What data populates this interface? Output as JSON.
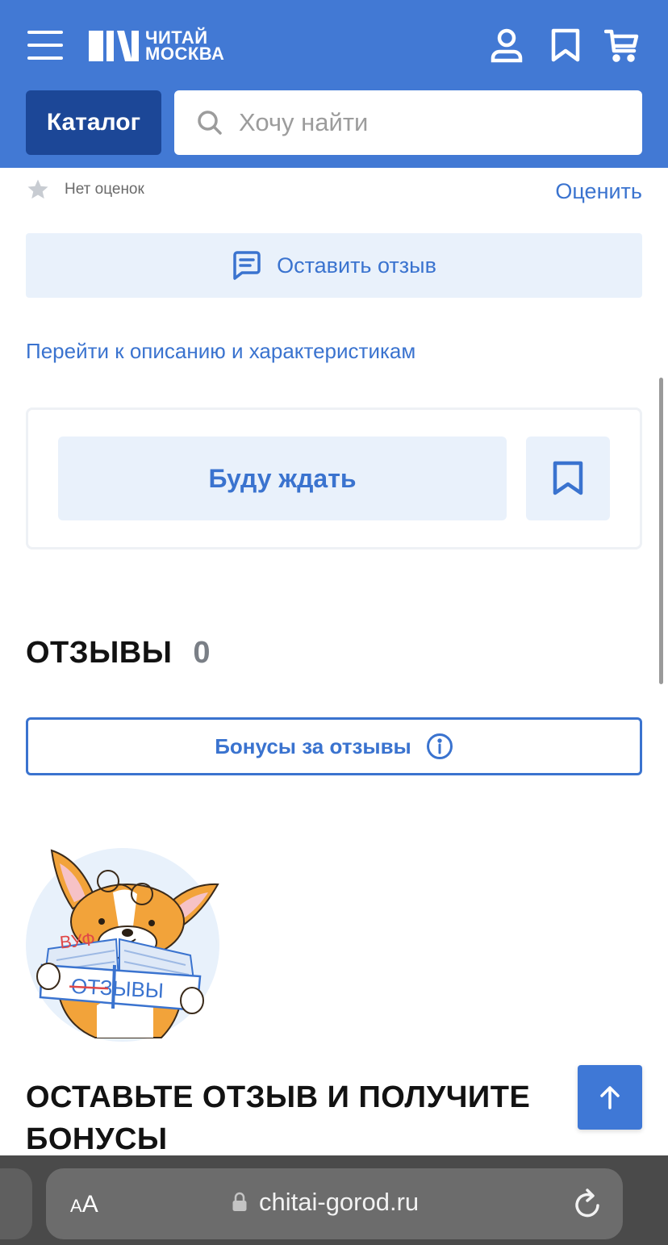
{
  "header": {
    "logo_line1": "ЧИТАЙ",
    "logo_line2": "МОСКВА",
    "catalog_label": "Каталог",
    "search_placeholder": "Хочу найти",
    "icons": [
      "menu-icon",
      "user-icon",
      "bookmark-icon",
      "cart-icon",
      "search-icon"
    ]
  },
  "rating": {
    "no_ratings_text": "Нет оценок",
    "rate_link": "Оценить"
  },
  "leave_review_label": "Оставить отзыв",
  "description_link": "Перейти к описанию и характеристикам",
  "wait_card": {
    "wait_label": "Буду ждать"
  },
  "reviews": {
    "title": "ОТЗЫВЫ",
    "count": "0",
    "bonus_button_label": "Бонусы за отзывы"
  },
  "illustration": {
    "word_new": "ВУФ",
    "word_old": "ОТЗЫВЫ"
  },
  "promo": {
    "title": "ОСТАВЬТЕ ОТЗЫВ И ПОЛУЧИТЕ БОНУСЫ"
  },
  "browser": {
    "text_size_small": "A",
    "text_size_large": "A",
    "url": "chitai-gorod.ru"
  },
  "colors": {
    "brand_blue": "#4279d4",
    "catalog_dark": "#1c4797",
    "link_blue": "#3a73cf",
    "light_blue_bg": "#e9f1fb"
  }
}
